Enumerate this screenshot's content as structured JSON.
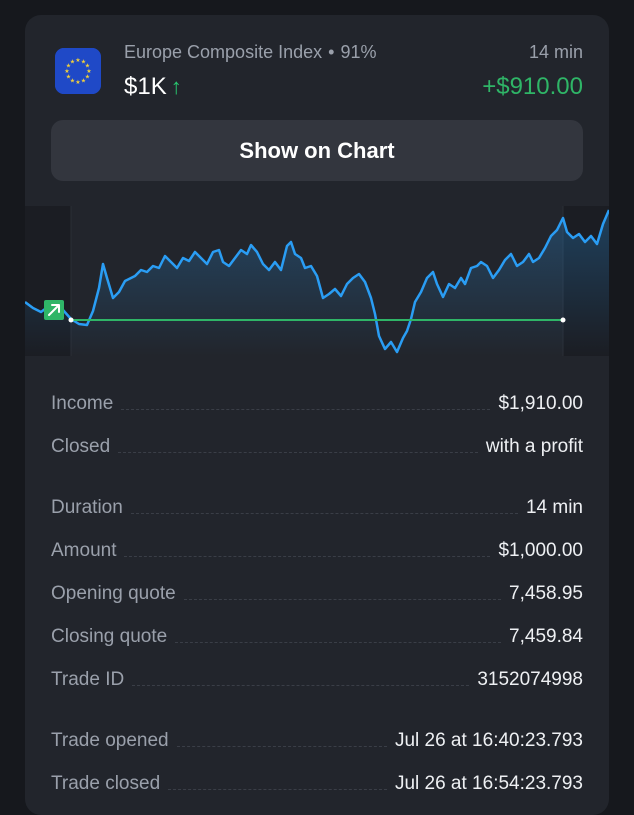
{
  "header": {
    "asset_name": "Europe Composite Index",
    "separator": "•",
    "payout": "91%",
    "amount": "$1K",
    "direction_icon": "arrow-up-icon",
    "duration": "14 min",
    "profit": "+$910.00"
  },
  "button": {
    "label": "Show on Chart"
  },
  "chart": {
    "direction": "up",
    "line_color": "#2a9df4",
    "strike_line_color": "#2fb567"
  },
  "details": {
    "income": {
      "label": "Income",
      "value": "$1,910.00"
    },
    "closed": {
      "label": "Closed",
      "value": "with a profit"
    },
    "duration": {
      "label": "Duration",
      "value": "14 min"
    },
    "amount": {
      "label": "Amount",
      "value": "$1,000.00"
    },
    "opening_quote": {
      "label": "Opening quote",
      "value": "7,458.95"
    },
    "closing_quote": {
      "label": "Closing quote",
      "value": "7,459.84"
    },
    "trade_id": {
      "label": "Trade ID",
      "value": "3152074998"
    },
    "trade_opened": {
      "label": "Trade opened",
      "value": "Jul 26 at 16:40:23.793"
    },
    "trade_closed": {
      "label": "Trade closed",
      "value": "Jul 26 at 16:54:23.793"
    }
  },
  "colors": {
    "background": "#16181d",
    "card": "#22252c",
    "button": "#33363e",
    "profit": "#2fb567",
    "muted_text": "#9aa0ab"
  }
}
